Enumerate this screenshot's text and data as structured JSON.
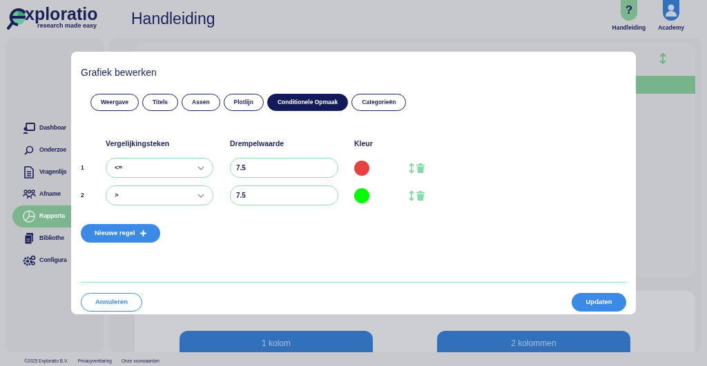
{
  "header": {
    "logo": {
      "name": "xploratio",
      "tagline": "research made easy"
    },
    "page_title": "Handleiding",
    "nav_buttons": [
      {
        "kind": "help",
        "glyph": "?",
        "label": "Handleiding"
      },
      {
        "kind": "academy",
        "label": "Academy"
      }
    ]
  },
  "sidebar": {
    "items": [
      {
        "label": "Dashboar",
        "selected": false
      },
      {
        "label": "Onderzoe",
        "selected": false
      },
      {
        "label": "Vragenlijs",
        "selected": false
      },
      {
        "label": "Afname",
        "selected": false
      },
      {
        "label": "Rapporta",
        "selected": true
      },
      {
        "label": "Bibliothe",
        "selected": false
      },
      {
        "label": "Configura",
        "selected": false
      }
    ]
  },
  "layout_buttons": [
    "1 kolom",
    "2 kolommen"
  ],
  "footer": [
    "©2025 Exploratio B.V.",
    "Privacyverklaring",
    "Onze voorwaarden"
  ],
  "modal": {
    "title": "Grafiek bewerken",
    "tabs": [
      {
        "label": "Weergave",
        "selected": false
      },
      {
        "label": "Titels",
        "selected": false
      },
      {
        "label": "Assen",
        "selected": false
      },
      {
        "label": "Plotlijn",
        "selected": false
      },
      {
        "label": "Conditionele Opmaak",
        "selected": true
      },
      {
        "label": "Categorieën",
        "selected": false
      }
    ],
    "columns": [
      "Vergelijkingsteken",
      "Drempelwaarde",
      "Kleur"
    ],
    "rules": [
      {
        "number": "1",
        "operator": "<=",
        "threshold": "7.5",
        "color": "#e84142"
      },
      {
        "number": "2",
        "operator": ">",
        "threshold": "7.5",
        "color": "#00ff00"
      }
    ],
    "add_button": "Nieuwe regel",
    "cancel_button": "Annuleren",
    "submit_button": "Updaten"
  }
}
